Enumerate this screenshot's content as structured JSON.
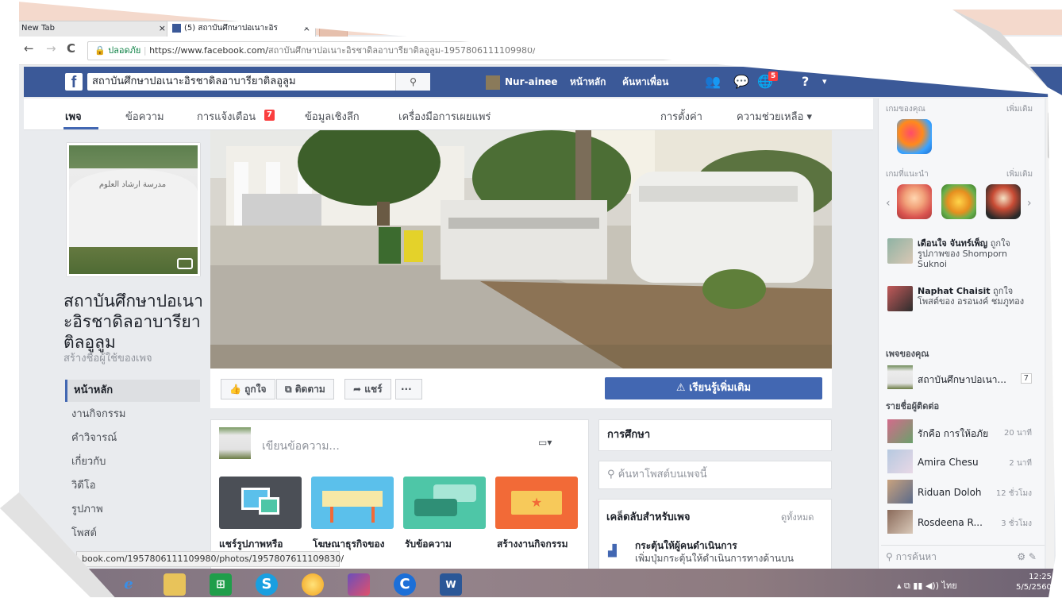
{
  "browser": {
    "tabs": [
      {
        "label": "New Tab",
        "close": "×"
      },
      {
        "label": "(5) สถาบันศึกษาปอเนาะอิร",
        "close": "×"
      }
    ],
    "nav": {
      "back": "←",
      "forward": "→",
      "reload": "C",
      "star": "☆"
    },
    "address": {
      "secure_label": "ปลอดภัย",
      "scheme_host": "https://www.facebook.com/",
      "path": "สถาบันศึกษาปอเนาะอิรชาดิลอาบารียาติลอูลูม-1957806111109980/"
    },
    "status_url": "book.com/1957806111109980/photos/1957807611109830/"
  },
  "fb_header": {
    "logo": "f",
    "search_value": "สถาบันศึกษาปอเนาะอิรชาดิลอาบารียาติลอูลูม",
    "search_icon": "search-icon",
    "user_name": "Nur-ainee",
    "home": "หน้าหลัก",
    "find_friends": "ค้นหาเพื่อน",
    "notif_count": "5",
    "help_icon": "?"
  },
  "page_nav": {
    "items": [
      "เพจ",
      "ข้อความ",
      "การแจ้งเตือน",
      "ข้อมูลเชิงลึก",
      "เครื่องมือการเผยแพร่"
    ],
    "notif_badge": "7",
    "settings": "การตั้งค่า",
    "help": "ความช่วยเหลือ ▾"
  },
  "page": {
    "name": "สถาบันศึกษาปอเนาะอิรชาดิลอาบารียาติลอูลูม",
    "create_username": "สร้างชื่อผู้ใช้ของเพจ",
    "left_nav": [
      "หน้าหลัก",
      "งานกิจกรรม",
      "คำวิจารณ์",
      "เกี่ยวกับ",
      "วิดีโอ",
      "รูปภาพ",
      "โพสต์"
    ]
  },
  "actions": {
    "like": "👍 ถูกใจ",
    "follow": "ติดตาม",
    "share": "แชร์",
    "more": "···",
    "learn_more": "⚠ เรียนรู้เพิ่มเติม"
  },
  "composer": {
    "placeholder": "เขียนข้อความ...",
    "tiles": [
      {
        "label": "แชร์รูปภาพหรือ",
        "color": "#4b4f56"
      },
      {
        "label": "โฆษณาธุรกิจของ",
        "color": "#5bc0eb"
      },
      {
        "label": "รับข้อความ",
        "color": "#4ec6a7"
      },
      {
        "label": "สร้างงานกิจกรรม",
        "color": "#f26a37"
      }
    ]
  },
  "right_mid": {
    "category": "การศึกษา",
    "search_placeholder": "ค้นหาโพสต์บนเพจนี้",
    "tips_title": "เคล็ดลับสำหรับเพจ",
    "tips_all": "ดูทั้งหมด",
    "tip_heading": "กระตุ้นให้ผู้คนดำเนินการ",
    "tip_text": "เพิ่มปุ่มกระตุ้นให้ดำเนินการทางด้านบน"
  },
  "sidebar": {
    "your_games": "เกมของคุณ",
    "see_more": "เพิ่มเติม",
    "suggested_games": "เกมที่แนะนำ",
    "activity": [
      {
        "name": "เดือนใจ จันทร์เพ็ญ",
        "text": "ถูกใจรูปภาพของ Shomporn Suknoi"
      },
      {
        "name": "Naphat Chaisit",
        "text": "ถูกใจโพสต์ของ อรอนงค์ ชมภูทอง"
      }
    ],
    "your_pages": "เพจของคุณ",
    "page_row": {
      "name": "สถาบันศึกษาปอเนา...",
      "count": "7"
    },
    "contacts_title": "รายชื่อผู้ติดต่อ",
    "contacts": [
      {
        "name": "รักคือ การให้อภัย",
        "time": "20 นาที"
      },
      {
        "name": "Amira Chesu",
        "time": "2 นาที"
      },
      {
        "name": "Riduan Doloh",
        "time": "12 ชั่วโมง"
      },
      {
        "name": "Rosdeena R...",
        "time": "3 ชั่วโมง"
      }
    ],
    "chat_search": "การค้นหา"
  },
  "taskbar": {
    "lang": "ไทย",
    "time": "12:25",
    "date": "5/5/2560"
  }
}
